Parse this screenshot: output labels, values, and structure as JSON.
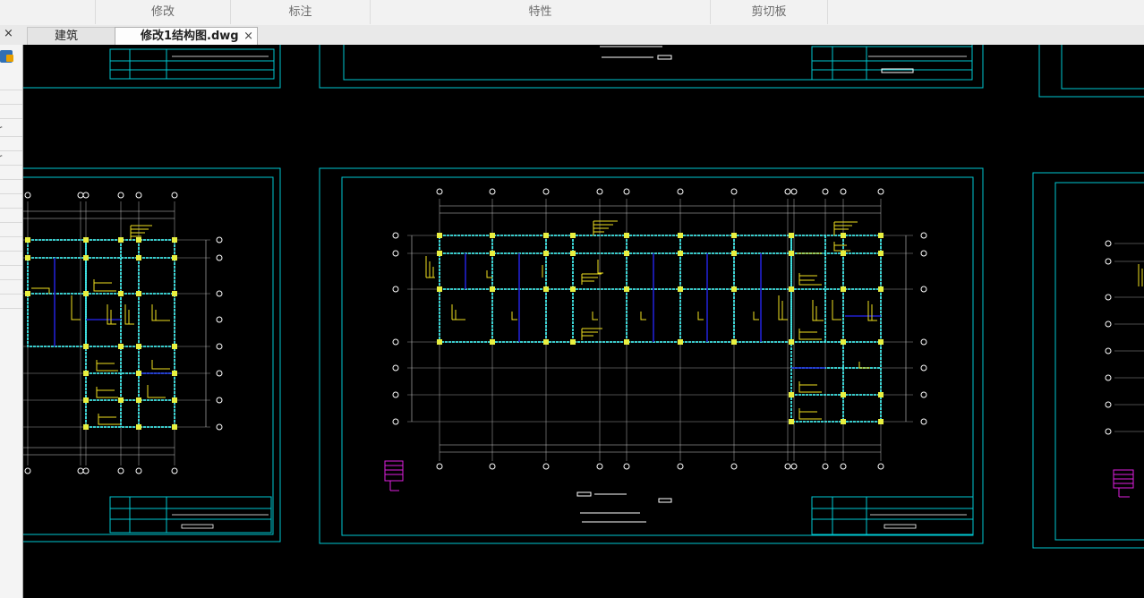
{
  "ribbon": {
    "groups": [
      "修改",
      "标注",
      "特性",
      "剪切板"
    ]
  },
  "tabs": [
    {
      "label": "建筑图.dwg",
      "active": false
    },
    {
      "label": "修改1结构图.dwg",
      "active": true,
      "close": "×"
    }
  ],
  "left_panel": {
    "close": "×",
    "rows": [
      "er",
      "er"
    ]
  },
  "drawing": {
    "background": "#000000",
    "frame_color": "#00c8d2",
    "grid_color": "#bcbcbc",
    "column_color": "#e8f040",
    "beam_color": "#40e8e8",
    "rebar_color": "#f0e020",
    "stair_color": "#e020e0"
  }
}
